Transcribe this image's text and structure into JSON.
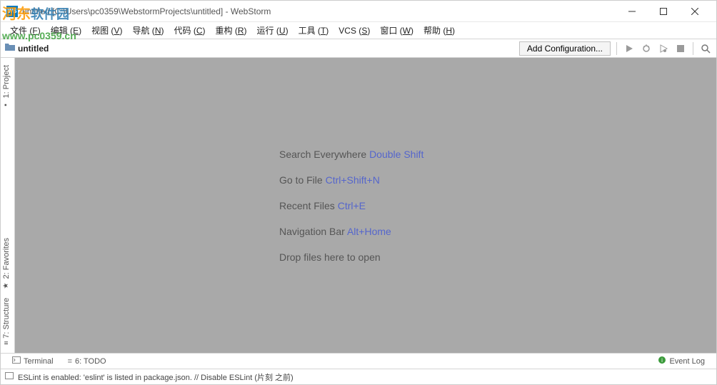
{
  "window": {
    "title": "untitled [C:\\Users\\pc0359\\WebstormProjects\\untitled] - WebStorm",
    "app_icon_text": "WS"
  },
  "watermark": {
    "line1_a": "河东",
    "line1_b": "软件园",
    "url": "www.pc0359.cn"
  },
  "menu": {
    "items": [
      {
        "label": "文件",
        "mnemonic": "F"
      },
      {
        "label": "编辑",
        "mnemonic": "E"
      },
      {
        "label": "视图",
        "mnemonic": "V"
      },
      {
        "label": "导航",
        "mnemonic": "N"
      },
      {
        "label": "代码",
        "mnemonic": "C"
      },
      {
        "label": "重构",
        "mnemonic": "R"
      },
      {
        "label": "运行",
        "mnemonic": "U"
      },
      {
        "label": "工具",
        "mnemonic": "T"
      },
      {
        "label": "VCS",
        "mnemonic": "S"
      },
      {
        "label": "窗口",
        "mnemonic": "W"
      },
      {
        "label": "帮助",
        "mnemonic": "H"
      }
    ]
  },
  "nav": {
    "breadcrumb": "untitled",
    "add_config": "Add Configuration..."
  },
  "left_tabs": {
    "project": "1: Project",
    "favorites": "2: Favorites",
    "structure": "7: Structure"
  },
  "hints": {
    "search": {
      "label": "Search Everywhere",
      "shortcut": "Double Shift"
    },
    "gotofile": {
      "label": "Go to File",
      "shortcut": "Ctrl+Shift+N"
    },
    "recent": {
      "label": "Recent Files",
      "shortcut": "Ctrl+E"
    },
    "navbar": {
      "label": "Navigation Bar",
      "shortcut": "Alt+Home"
    },
    "drop": {
      "label": "Drop files here to open"
    }
  },
  "bottom": {
    "terminal": "Terminal",
    "todo": "6: TODO",
    "eventlog": "Event Log"
  },
  "status": {
    "text": "ESLint is enabled: 'eslint' is listed in package.json. // Disable ESLint (片刻 之前)"
  }
}
